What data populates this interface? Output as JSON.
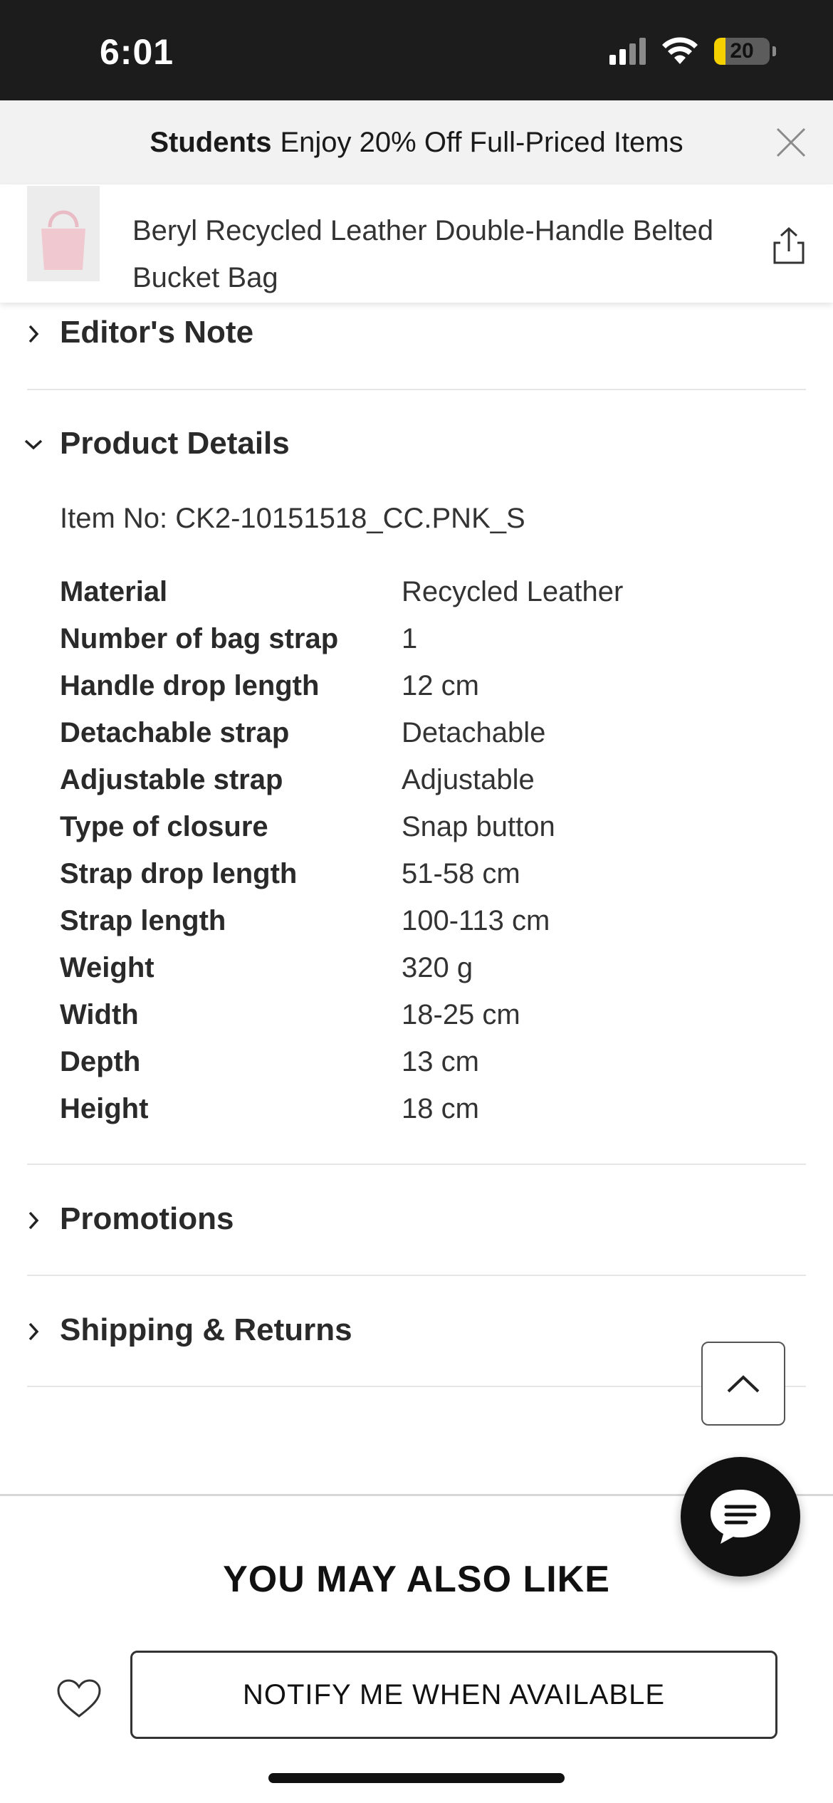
{
  "status_bar": {
    "time": "6:01",
    "battery_level": "20",
    "battery_fraction": 0.2,
    "icons": [
      "cellular-signal-icon",
      "wifi-icon",
      "battery-icon"
    ]
  },
  "promo_banner": {
    "bold": "Students",
    "text": "Enjoy 20% Off Full-Priced Items"
  },
  "product": {
    "name": "Beryl Recycled Leather Double-Handle Belted Bucket Bag",
    "thumb_color": "#f0c9d0"
  },
  "sections": {
    "editors_note": "Editor's Note",
    "product_details": "Product Details",
    "promotions": "Promotions",
    "shipping_returns": "Shipping & Returns"
  },
  "details": {
    "item_no": "Item No: CK2-10151518_CC.PNK_S",
    "specs": [
      {
        "label": "Material",
        "value": "Recycled Leather"
      },
      {
        "label": "Number of bag strap",
        "value": "1"
      },
      {
        "label": "Handle drop length",
        "value": "12 cm"
      },
      {
        "label": "Detachable strap",
        "value": "Detachable"
      },
      {
        "label": "Adjustable strap",
        "value": "Adjustable"
      },
      {
        "label": "Type of closure",
        "value": "Snap button"
      },
      {
        "label": "Strap drop length",
        "value": "51-58 cm"
      },
      {
        "label": "Strap length",
        "value": "100-113 cm"
      },
      {
        "label": "Weight",
        "value": "320 g"
      },
      {
        "label": "Width",
        "value": "18-25 cm"
      },
      {
        "label": "Depth",
        "value": "13 cm"
      },
      {
        "label": "Height",
        "value": "18 cm"
      }
    ]
  },
  "recommendations": {
    "title": "YOU MAY ALSO LIKE"
  },
  "footer": {
    "notify_label": "NOTIFY ME WHEN AVAILABLE"
  },
  "colors": {
    "status_bar_bg": "#1c1c1c",
    "banner_bg": "#f2f2f2",
    "battery_accent": "#f5d100",
    "chat_button_bg": "#111111"
  }
}
